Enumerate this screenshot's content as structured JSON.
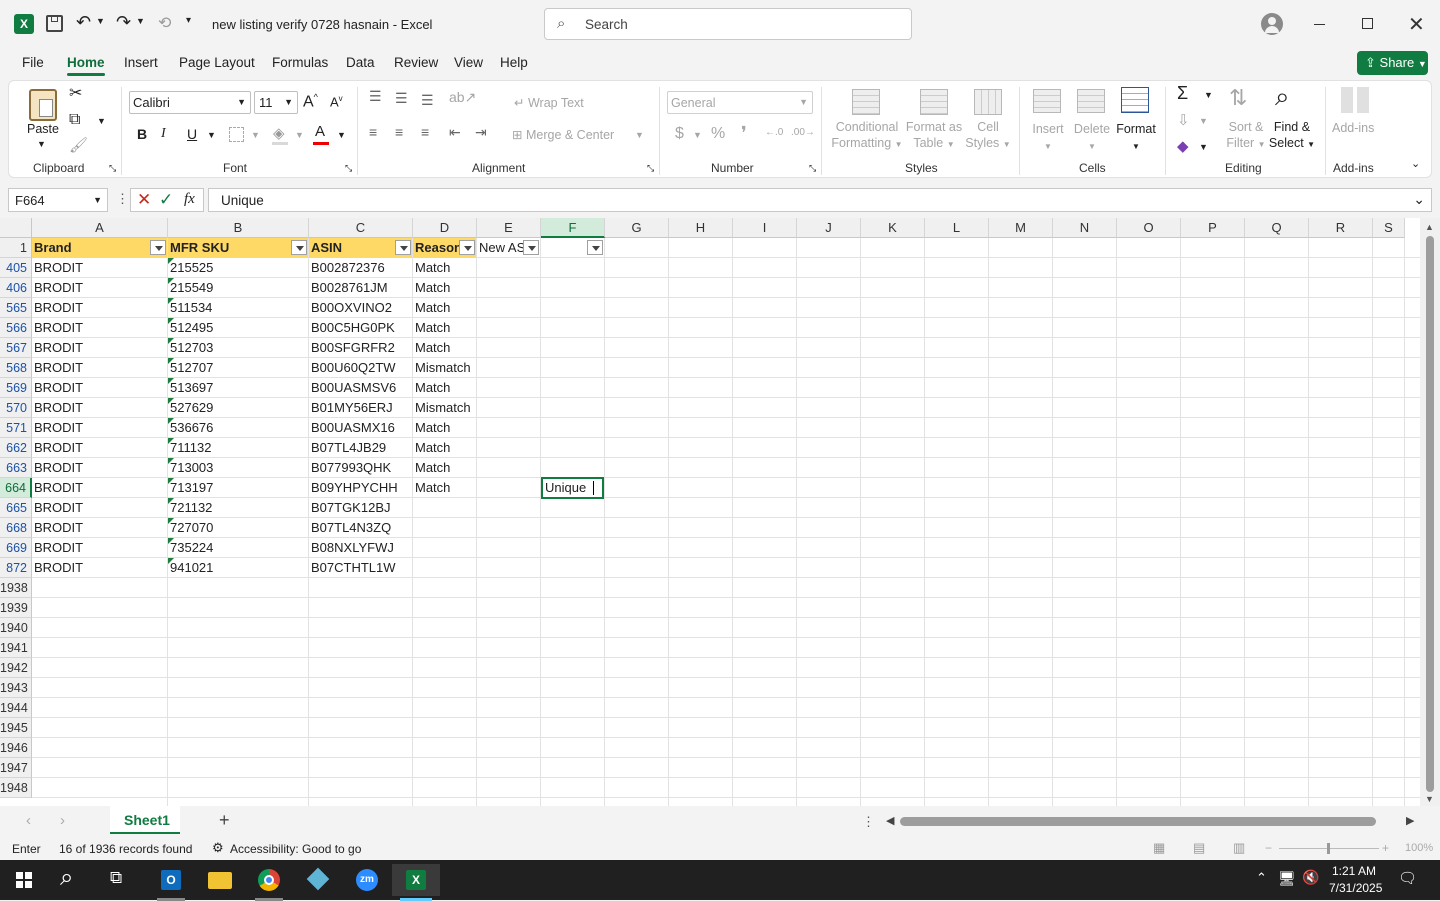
{
  "titlebar": {
    "filename": "new listing verify 0728 hasnain",
    "app": "Excel",
    "separator": "-",
    "search_placeholder": "Search"
  },
  "menu": {
    "tabs": [
      "File",
      "Home",
      "Insert",
      "Page Layout",
      "Formulas",
      "Data",
      "Review",
      "View",
      "Help"
    ],
    "share_label": "Share"
  },
  "ribbon": {
    "clipboard": {
      "paste": "Paste",
      "label": "Clipboard"
    },
    "font": {
      "name": "Calibri",
      "size": "11",
      "label": "Font",
      "bold": "B",
      "italic": "I",
      "underline": "U"
    },
    "alignment": {
      "wrap_text": "Wrap Text",
      "merge_center": "Merge & Center",
      "label": "Alignment"
    },
    "number": {
      "format": "General",
      "label": "Number",
      "currency": "$",
      "percent": "%"
    },
    "styles": {
      "conditional1": "Conditional",
      "conditional2": "Formatting",
      "format_table1": "Format as",
      "format_table2": "Table",
      "cell_styles1": "Cell",
      "cell_styles2": "Styles",
      "label": "Styles"
    },
    "cells": {
      "insert": "Insert",
      "delete": "Delete",
      "format": "Format",
      "label": "Cells"
    },
    "editing": {
      "sort1": "Sort &",
      "sort2": "Filter",
      "find1": "Find &",
      "find2": "Select",
      "label": "Editing"
    },
    "addins": {
      "addins": "Add-ins",
      "label": "Add-ins"
    }
  },
  "formula_bar": {
    "name_box": "F664",
    "fx": "fx",
    "content": "Unique"
  },
  "columns": [
    "A",
    "B",
    "C",
    "D",
    "E",
    "F",
    "G",
    "H",
    "I",
    "J",
    "K",
    "L",
    "M",
    "N",
    "O",
    "P",
    "Q",
    "R",
    "S"
  ],
  "header_row": {
    "row": "1",
    "cells": [
      "Brand",
      "MFR SKU",
      "ASIN",
      "Reason",
      "New AS",
      "",
      ""
    ]
  },
  "rows": [
    {
      "row": "405",
      "brand": "BRODIT",
      "sku": "215525",
      "asin": "B002872376",
      "reason": "Match"
    },
    {
      "row": "406",
      "brand": "BRODIT",
      "sku": "215549",
      "asin": "B0028761JM",
      "reason": "Match"
    },
    {
      "row": "565",
      "brand": "BRODIT",
      "sku": "511534",
      "asin": "B00OXVINO2",
      "reason": "Match"
    },
    {
      "row": "566",
      "brand": "BRODIT",
      "sku": "512495",
      "asin": "B00C5HG0PK",
      "reason": "Match"
    },
    {
      "row": "567",
      "brand": "BRODIT",
      "sku": "512703",
      "asin": "B00SFGRFR2",
      "reason": "Match"
    },
    {
      "row": "568",
      "brand": "BRODIT",
      "sku": "512707",
      "asin": "B00U60Q2TW",
      "reason": "Mismatch"
    },
    {
      "row": "569",
      "brand": "BRODIT",
      "sku": "513697",
      "asin": "B00UASMSV6",
      "reason": "Match"
    },
    {
      "row": "570",
      "brand": "BRODIT",
      "sku": "527629",
      "asin": "B01MY56ERJ",
      "reason": "Mismatch"
    },
    {
      "row": "571",
      "brand": "BRODIT",
      "sku": "536676",
      "asin": "B00UASMX16",
      "reason": "Match"
    },
    {
      "row": "662",
      "brand": "BRODIT",
      "sku": "711132",
      "asin": "B07TL4JB29",
      "reason": "Match"
    },
    {
      "row": "663",
      "brand": "BRODIT",
      "sku": "713003",
      "asin": "B077993QHK",
      "reason": "Match"
    },
    {
      "row": "664",
      "brand": "BRODIT",
      "sku": "713197",
      "asin": "B09YHPYCHH",
      "reason": "Match",
      "f": "Unique"
    },
    {
      "row": "665",
      "brand": "BRODIT",
      "sku": "721132",
      "asin": "B07TGK12BJ",
      "reason": ""
    },
    {
      "row": "668",
      "brand": "BRODIT",
      "sku": "727070",
      "asin": "B07TL4N3ZQ",
      "reason": ""
    },
    {
      "row": "669",
      "brand": "BRODIT",
      "sku": "735224",
      "asin": "B08NXLYFWJ",
      "reason": ""
    },
    {
      "row": "872",
      "brand": "BRODIT",
      "sku": "941021",
      "asin": "B07CTHTL1W",
      "reason": ""
    }
  ],
  "empty_rows": [
    "1938",
    "1939",
    "1940",
    "1941",
    "1942",
    "1943",
    "1944",
    "1945",
    "1946",
    "1947",
    "1948"
  ],
  "sheets": {
    "active": "Sheet1",
    "add": "+"
  },
  "status": {
    "mode": "Enter",
    "records": "16 of 1936 records found",
    "accessibility": "Accessibility: Good to go",
    "zoom": "100%"
  },
  "taskbar": {
    "time": "1:21 AM",
    "date": "7/31/2025"
  },
  "colors": {
    "excel_green": "#107c41",
    "header_fill": "#ffd966",
    "taskbar": "#202020"
  }
}
